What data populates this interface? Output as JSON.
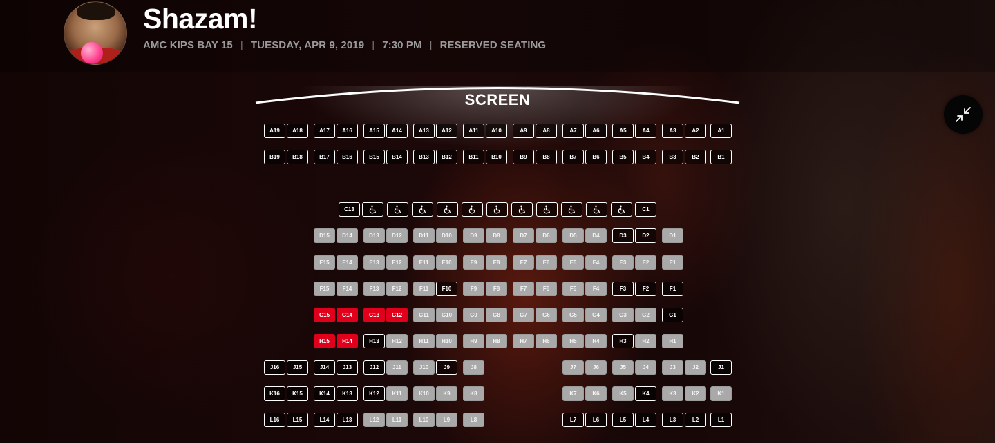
{
  "movie": {
    "title": "Shazam!",
    "theater": "AMC KIPS BAY 15",
    "date": "TUESDAY, APR 9, 2019",
    "time": "7:30 PM",
    "seating_type": "RESERVED SEATING",
    "separator": "|"
  },
  "screen": {
    "label": "SCREEN"
  },
  "controls": {
    "collapse_icon": "collapse-arrows-icon"
  },
  "colors": {
    "selected": "#e0001b",
    "taken": "#a9a9a9",
    "available": "#ffffff",
    "background": "#0f0606"
  },
  "seat_rows": [
    {
      "row": "A",
      "seats": [
        {
          "label": "A19",
          "col": 0,
          "state": "available"
        },
        {
          "label": "A18",
          "col": 1,
          "state": "available"
        },
        {
          "label": "A17",
          "col": 2,
          "state": "available"
        },
        {
          "label": "A16",
          "col": 3,
          "state": "available"
        },
        {
          "label": "A15",
          "col": 4,
          "state": "available"
        },
        {
          "label": "A14",
          "col": 5,
          "state": "available"
        },
        {
          "label": "A13",
          "col": 6,
          "state": "available"
        },
        {
          "label": "A12",
          "col": 7,
          "state": "available"
        },
        {
          "label": "A11",
          "col": 8,
          "state": "available"
        },
        {
          "label": "A10",
          "col": 9,
          "state": "available"
        },
        {
          "label": "A9",
          "col": 10,
          "state": "available"
        },
        {
          "label": "A8",
          "col": 11,
          "state": "available"
        },
        {
          "label": "A7",
          "col": 12,
          "state": "available"
        },
        {
          "label": "A6",
          "col": 13,
          "state": "available"
        },
        {
          "label": "A5",
          "col": 14,
          "state": "available"
        },
        {
          "label": "A4",
          "col": 15,
          "state": "available"
        },
        {
          "label": "A3",
          "col": 16,
          "state": "available"
        },
        {
          "label": "A2",
          "col": 17,
          "state": "available"
        },
        {
          "label": "A1",
          "col": 18,
          "state": "available"
        }
      ]
    },
    {
      "row": "B",
      "seats": [
        {
          "label": "B19",
          "col": 0,
          "state": "available"
        },
        {
          "label": "B18",
          "col": 1,
          "state": "available"
        },
        {
          "label": "B17",
          "col": 2,
          "state": "available"
        },
        {
          "label": "B16",
          "col": 3,
          "state": "available"
        },
        {
          "label": "B15",
          "col": 4,
          "state": "available"
        },
        {
          "label": "B14",
          "col": 5,
          "state": "available"
        },
        {
          "label": "B13",
          "col": 6,
          "state": "available"
        },
        {
          "label": "B12",
          "col": 7,
          "state": "available"
        },
        {
          "label": "B11",
          "col": 8,
          "state": "available"
        },
        {
          "label": "B10",
          "col": 9,
          "state": "available"
        },
        {
          "label": "B9",
          "col": 10,
          "state": "available"
        },
        {
          "label": "B8",
          "col": 11,
          "state": "available"
        },
        {
          "label": "B7",
          "col": 12,
          "state": "available"
        },
        {
          "label": "B6",
          "col": 13,
          "state": "available"
        },
        {
          "label": "B5",
          "col": 14,
          "state": "available"
        },
        {
          "label": "B4",
          "col": 15,
          "state": "available"
        },
        {
          "label": "B3",
          "col": 16,
          "state": "available"
        },
        {
          "label": "B2",
          "col": 17,
          "state": "available"
        },
        {
          "label": "B1",
          "col": 18,
          "state": "available"
        }
      ]
    },
    {
      "row": "C",
      "seats": [
        {
          "label": "C13",
          "col": "c0",
          "state": "available"
        },
        {
          "label": "",
          "col": "c1",
          "state": "wheelchair"
        },
        {
          "label": "",
          "col": "c2",
          "state": "wheelchair"
        },
        {
          "label": "",
          "col": "c3",
          "state": "wheelchair"
        },
        {
          "label": "",
          "col": "c4",
          "state": "wheelchair"
        },
        {
          "label": "",
          "col": "c5",
          "state": "wheelchair"
        },
        {
          "label": "",
          "col": "c6",
          "state": "wheelchair"
        },
        {
          "label": "",
          "col": "c7",
          "state": "wheelchair"
        },
        {
          "label": "",
          "col": "c8",
          "state": "wheelchair"
        },
        {
          "label": "",
          "col": "c9",
          "state": "wheelchair"
        },
        {
          "label": "",
          "col": "c10",
          "state": "wheelchair"
        },
        {
          "label": "",
          "col": "c11",
          "state": "wheelchair"
        },
        {
          "label": "C1",
          "col": "c12",
          "state": "available"
        }
      ]
    },
    {
      "row": "D",
      "seats": [
        {
          "label": "D15",
          "col": 2,
          "state": "taken"
        },
        {
          "label": "D14",
          "col": 3,
          "state": "taken"
        },
        {
          "label": "D13",
          "col": 4,
          "state": "taken"
        },
        {
          "label": "D12",
          "col": 5,
          "state": "taken"
        },
        {
          "label": "D11",
          "col": 6,
          "state": "taken"
        },
        {
          "label": "D10",
          "col": 7,
          "state": "taken"
        },
        {
          "label": "D9",
          "col": 8,
          "state": "taken"
        },
        {
          "label": "D8",
          "col": 9,
          "state": "taken"
        },
        {
          "label": "D7",
          "col": 10,
          "state": "taken"
        },
        {
          "label": "D6",
          "col": 11,
          "state": "taken"
        },
        {
          "label": "D5",
          "col": 12,
          "state": "taken"
        },
        {
          "label": "D4",
          "col": 13,
          "state": "taken"
        },
        {
          "label": "D3",
          "col": 14,
          "state": "available"
        },
        {
          "label": "D2",
          "col": 15,
          "state": "available"
        },
        {
          "label": "D1",
          "col": 16,
          "state": "taken"
        }
      ]
    },
    {
      "row": "E",
      "seats": [
        {
          "label": "E15",
          "col": 2,
          "state": "taken"
        },
        {
          "label": "E14",
          "col": 3,
          "state": "taken"
        },
        {
          "label": "E13",
          "col": 4,
          "state": "taken"
        },
        {
          "label": "E12",
          "col": 5,
          "state": "taken"
        },
        {
          "label": "E11",
          "col": 6,
          "state": "taken"
        },
        {
          "label": "E10",
          "col": 7,
          "state": "taken"
        },
        {
          "label": "E9",
          "col": 8,
          "state": "taken"
        },
        {
          "label": "E8",
          "col": 9,
          "state": "taken"
        },
        {
          "label": "E7",
          "col": 10,
          "state": "taken"
        },
        {
          "label": "E6",
          "col": 11,
          "state": "taken"
        },
        {
          "label": "E5",
          "col": 12,
          "state": "taken"
        },
        {
          "label": "E4",
          "col": 13,
          "state": "taken"
        },
        {
          "label": "E3",
          "col": 14,
          "state": "taken"
        },
        {
          "label": "E2",
          "col": 15,
          "state": "taken"
        },
        {
          "label": "E1",
          "col": 16,
          "state": "taken"
        }
      ]
    },
    {
      "row": "F",
      "seats": [
        {
          "label": "F15",
          "col": 2,
          "state": "taken"
        },
        {
          "label": "F14",
          "col": 3,
          "state": "taken"
        },
        {
          "label": "F13",
          "col": 4,
          "state": "taken"
        },
        {
          "label": "F12",
          "col": 5,
          "state": "taken"
        },
        {
          "label": "F11",
          "col": 6,
          "state": "taken"
        },
        {
          "label": "F10",
          "col": 7,
          "state": "available"
        },
        {
          "label": "F9",
          "col": 8,
          "state": "taken"
        },
        {
          "label": "F8",
          "col": 9,
          "state": "taken"
        },
        {
          "label": "F7",
          "col": 10,
          "state": "taken"
        },
        {
          "label": "F6",
          "col": 11,
          "state": "taken"
        },
        {
          "label": "F5",
          "col": 12,
          "state": "taken"
        },
        {
          "label": "F4",
          "col": 13,
          "state": "taken"
        },
        {
          "label": "F3",
          "col": 14,
          "state": "available"
        },
        {
          "label": "F2",
          "col": 15,
          "state": "available"
        },
        {
          "label": "F1",
          "col": 16,
          "state": "available"
        }
      ]
    },
    {
      "row": "G",
      "seats": [
        {
          "label": "G15",
          "col": 2,
          "state": "selected"
        },
        {
          "label": "G14",
          "col": 3,
          "state": "selected"
        },
        {
          "label": "G13",
          "col": 4,
          "state": "selected"
        },
        {
          "label": "G12",
          "col": 5,
          "state": "selected"
        },
        {
          "label": "G11",
          "col": 6,
          "state": "taken"
        },
        {
          "label": "G10",
          "col": 7,
          "state": "taken"
        },
        {
          "label": "G9",
          "col": 8,
          "state": "taken"
        },
        {
          "label": "G8",
          "col": 9,
          "state": "taken"
        },
        {
          "label": "G7",
          "col": 10,
          "state": "taken"
        },
        {
          "label": "G6",
          "col": 11,
          "state": "taken"
        },
        {
          "label": "G5",
          "col": 12,
          "state": "taken"
        },
        {
          "label": "G4",
          "col": 13,
          "state": "taken"
        },
        {
          "label": "G3",
          "col": 14,
          "state": "taken"
        },
        {
          "label": "G2",
          "col": 15,
          "state": "taken"
        },
        {
          "label": "G1",
          "col": 16,
          "state": "available"
        }
      ]
    },
    {
      "row": "H",
      "seats": [
        {
          "label": "H15",
          "col": 2,
          "state": "selected"
        },
        {
          "label": "H14",
          "col": 3,
          "state": "selected"
        },
        {
          "label": "H13",
          "col": 4,
          "state": "available"
        },
        {
          "label": "H12",
          "col": 5,
          "state": "taken"
        },
        {
          "label": "H11",
          "col": 6,
          "state": "taken"
        },
        {
          "label": "H10",
          "col": 7,
          "state": "taken"
        },
        {
          "label": "H9",
          "col": 8,
          "state": "taken"
        },
        {
          "label": "H8",
          "col": 9,
          "state": "taken"
        },
        {
          "label": "H7",
          "col": 10,
          "state": "taken"
        },
        {
          "label": "H6",
          "col": 11,
          "state": "taken"
        },
        {
          "label": "H5",
          "col": 12,
          "state": "taken"
        },
        {
          "label": "H4",
          "col": 13,
          "state": "taken"
        },
        {
          "label": "H3",
          "col": 14,
          "state": "available"
        },
        {
          "label": "H2",
          "col": 15,
          "state": "taken"
        },
        {
          "label": "H1",
          "col": 16,
          "state": "taken"
        }
      ]
    },
    {
      "row": "J",
      "seats": [
        {
          "label": "J16",
          "col": 0,
          "state": "available"
        },
        {
          "label": "J15",
          "col": 1,
          "state": "available"
        },
        {
          "label": "J14",
          "col": 2,
          "state": "available"
        },
        {
          "label": "J13",
          "col": 3,
          "state": "available"
        },
        {
          "label": "J12",
          "col": 4,
          "state": "available"
        },
        {
          "label": "J11",
          "col": 5,
          "state": "taken"
        },
        {
          "label": "J10",
          "col": 6,
          "state": "taken"
        },
        {
          "label": "J9",
          "col": 7,
          "state": "available"
        },
        {
          "label": "J8",
          "col": 8,
          "state": "taken"
        },
        {
          "label": "J7",
          "col": 12,
          "state": "taken"
        },
        {
          "label": "J6",
          "col": 13,
          "state": "taken"
        },
        {
          "label": "J5",
          "col": 14,
          "state": "taken"
        },
        {
          "label": "J4",
          "col": 15,
          "state": "taken"
        },
        {
          "label": "J3",
          "col": 16,
          "state": "taken"
        },
        {
          "label": "J2",
          "col": 17,
          "state": "taken"
        },
        {
          "label": "J1",
          "col": 18,
          "state": "available"
        }
      ]
    },
    {
      "row": "K",
      "seats": [
        {
          "label": "K16",
          "col": 0,
          "state": "available"
        },
        {
          "label": "K15",
          "col": 1,
          "state": "available"
        },
        {
          "label": "K14",
          "col": 2,
          "state": "available"
        },
        {
          "label": "K13",
          "col": 3,
          "state": "available"
        },
        {
          "label": "K12",
          "col": 4,
          "state": "available"
        },
        {
          "label": "K11",
          "col": 5,
          "state": "taken"
        },
        {
          "label": "K10",
          "col": 6,
          "state": "taken"
        },
        {
          "label": "K9",
          "col": 7,
          "state": "taken"
        },
        {
          "label": "K8",
          "col": 8,
          "state": "taken"
        },
        {
          "label": "K7",
          "col": 12,
          "state": "taken"
        },
        {
          "label": "K6",
          "col": 13,
          "state": "taken"
        },
        {
          "label": "K5",
          "col": 14,
          "state": "taken"
        },
        {
          "label": "K4",
          "col": 15,
          "state": "available"
        },
        {
          "label": "K3",
          "col": 16,
          "state": "taken"
        },
        {
          "label": "K2",
          "col": 17,
          "state": "taken"
        },
        {
          "label": "K1",
          "col": 18,
          "state": "taken"
        }
      ]
    },
    {
      "row": "L",
      "seats": [
        {
          "label": "L16",
          "col": 0,
          "state": "available"
        },
        {
          "label": "L15",
          "col": 1,
          "state": "available"
        },
        {
          "label": "L14",
          "col": 2,
          "state": "available"
        },
        {
          "label": "L13",
          "col": 3,
          "state": "available"
        },
        {
          "label": "L12",
          "col": 4,
          "state": "taken"
        },
        {
          "label": "L11",
          "col": 5,
          "state": "taken"
        },
        {
          "label": "L10",
          "col": 6,
          "state": "taken"
        },
        {
          "label": "L9",
          "col": 7,
          "state": "taken"
        },
        {
          "label": "L8",
          "col": 8,
          "state": "taken"
        },
        {
          "label": "L7",
          "col": 12,
          "state": "available"
        },
        {
          "label": "L6",
          "col": 13,
          "state": "available"
        },
        {
          "label": "L5",
          "col": 14,
          "state": "available"
        },
        {
          "label": "L4",
          "col": 15,
          "state": "available"
        },
        {
          "label": "L3",
          "col": 16,
          "state": "available"
        },
        {
          "label": "L2",
          "col": 17,
          "state": "available"
        },
        {
          "label": "L1",
          "col": 18,
          "state": "available"
        }
      ]
    }
  ]
}
